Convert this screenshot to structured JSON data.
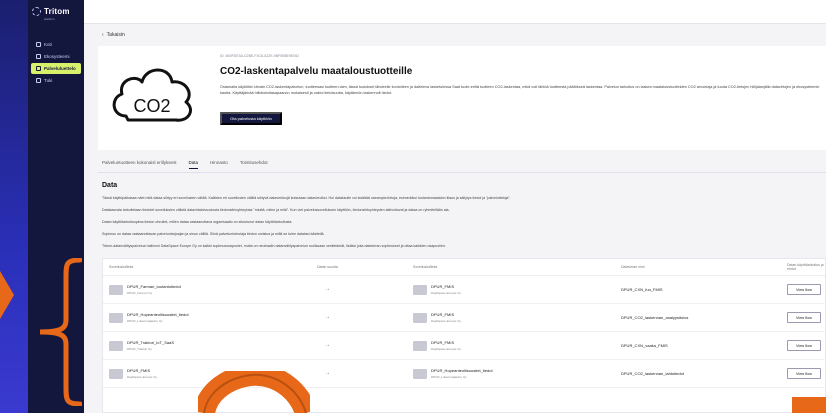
{
  "brand": {
    "name": "Tritom",
    "tagline": "platform"
  },
  "nav": {
    "items": [
      {
        "label": "Koti",
        "icon": "home-icon",
        "active": false
      },
      {
        "label": "Ekosysteemi",
        "icon": "network-icon",
        "active": false
      },
      {
        "label": "Palveluluettelo",
        "icon": "catalog-icon",
        "active": true
      },
      {
        "label": "Tuki",
        "icon": "help-icon",
        "active": false
      }
    ]
  },
  "back_label": "Takaisin",
  "product": {
    "eyebrow": "ID: 4B0FDE3A-D2BE-F4C8-A22E-9BF0B8E9E052",
    "title": "CO2-laskentapalvelu maataloustuotteille",
    "image_text": "CO2",
    "description": "Ostamalla käytöltön tämän CO2-laskentapalvelun, tuotteesasi tuotteen laim, tässä tuotokset lähdeelle kontolleen ja dalteleva lasketulessa Saat tuote-eriltä tuotteen CO2-laskentaa, mikä voit lähtöä tuotteesta päätökseä laskentaa. Palvelun tarkoitus on laskea maataloustuotteiden CO2 arvontaja ja tuoda CO2-tietojen hiilijalanjälki datavirtojen ja ekosysteemin kautta. Käyttäjämää hiilidioksitasapaanon mukaisesti ja vakioi tietoisuutta, käytännön laskennoit tiedot.",
    "cta_label": "Ota palvelusta käyttöön"
  },
  "tabs": [
    {
      "label": "Palveluntuotteen kokonaisl erillyksest",
      "active": false
    },
    {
      "label": "Data",
      "active": true
    },
    {
      "label": "Hinnasto",
      "active": false
    },
    {
      "label": "Toimitusehdot",
      "active": false
    }
  ],
  "data_section": {
    "title": "Data",
    "paragraphs": [
      "Tässä käyttöpaikassa näet mitä dataa siirtyy eri sovellusten välillä. Kaikkien eri sovellusten väliltä siirtyvä dataverkkojä kutsutaan datavirroiksi. Hoi dataksulle voi sisältää useampia tietoja, esimerkiksi tuotantomaatalon tilaus ja säilytys tiedot ja \"palvelutietoja\".",
      "Datakasvala tarkoitetaan tiedotet sovelluksien välistä datavirtaloivuodosta tiedonsiirtoyhteyksia \"miuttä, mitne ja mitä\". Kun viet palvelussovelluksen käyttöön, tiedonsiirtoyhteyden aktivoituvat ja dataa on ryhmitellään ala.",
      "Datan käyttötarkoituspima tiedon ohrutlet, millen dataa vastaanottava organisaatio on sitoutunut datan käyttötarkoitusta.",
      "Sopimus on dataa vastaanottavan palveluntarjoajan ja sinun välillä. Siinä palveluntoteutaja tiedon omistus ja millä se tulee datatasi käsitellä.",
      "Tritom-datanvälityspalvelua hallinnoi DataSpace Europe Oy on kaikki sopimusosapuolet, mutta on neutraalin datanvälityspalvelun roolissaan veräteämät, lisäksi joka datavirran sopimukset ja ottaa kaikkien osapuolien."
    ]
  },
  "table": {
    "headers": [
      "Sovellushallinta",
      "Datan suunta",
      "Sovellushallinta",
      "Datavirran nimi",
      "Datan käyttötarkoitus ja ehdot"
    ],
    "rows": [
      {
        "source": "DPUR_Farmari_tuotantotiedot",
        "source_org": "DPUR_Farmari Oy",
        "direction": "→",
        "target": "DPUR_FMIS",
        "target_org": "DataSpace Europe Oy",
        "flow": "DPUR_CXN_fuu_FMIS",
        "action": "View flow"
      },
      {
        "source": "DPUR_Hopeanteollisuustiet_tiedot",
        "source_org": "DPUR_Lukemusjaksho Oy",
        "direction": "→",
        "target": "DPUR_FMIS",
        "target_org": "DataSpace Europe Oy",
        "flow": "DPUR_CO2_laskennan_analyysitulos",
        "action": "View flow"
      },
      {
        "source": "DPUR_Traktori_IoT_SaaS",
        "source_org": "DPUR_Traktori Oy",
        "direction": "→",
        "target": "DPUR_FMIS",
        "target_org": "DataSpace Europe Oy",
        "flow": "DPUR_CXN_vaaka_FMIS",
        "action": "View flow"
      },
      {
        "source": "DPUR_FMIS",
        "source_org": "DataSpace Europe Oy",
        "direction": "→",
        "target": "DPUR_Hopeanteollisuustiet_tiedot",
        "target_org": "DPUR_Lukemusjaksho Oy",
        "flow": "DPUR_CO2_laskennan_lahtotiedot",
        "action": "View flow"
      }
    ]
  },
  "colors": {
    "accent": "#d9f06a",
    "sidebar": "#14173d",
    "annotation": "#e8681a",
    "backdrop": "#2a2fb8"
  }
}
